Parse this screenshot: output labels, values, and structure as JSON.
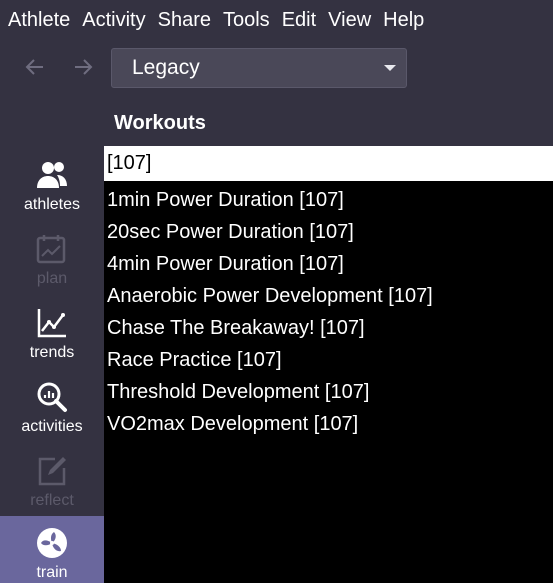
{
  "menu": [
    "Athlete",
    "Activity",
    "Share",
    "Tools",
    "Edit",
    "View",
    "Help"
  ],
  "toolbar": {
    "back_icon": "arrow-left-icon",
    "forward_icon": "arrow-right-icon",
    "view_select_value": "Legacy"
  },
  "sidebar": {
    "items": [
      {
        "label": "athletes",
        "icon": "athletes-icon",
        "enabled": true,
        "active": false
      },
      {
        "label": "plan",
        "icon": "plan-icon",
        "enabled": false,
        "active": false
      },
      {
        "label": "trends",
        "icon": "trends-icon",
        "enabled": true,
        "active": false
      },
      {
        "label": "activities",
        "icon": "activities-icon",
        "enabled": true,
        "active": false
      },
      {
        "label": "reflect",
        "icon": "reflect-icon",
        "enabled": false,
        "active": false
      },
      {
        "label": "train",
        "icon": "train-icon",
        "enabled": true,
        "active": true
      }
    ]
  },
  "workouts": {
    "title": "Workouts",
    "filter_value": "[107]",
    "items": [
      "1min Power Duration [107]",
      "20sec Power Duration [107]",
      "4min Power Duration [107]",
      "Anaerobic Power Development [107]",
      "Chase The Breakaway! [107]",
      "Race Practice [107]",
      "Threshold Development [107]",
      "VO2max Development [107]"
    ]
  },
  "colors": {
    "background": "#343241",
    "active_sidebar": "#6a679d",
    "list_background": "#000000",
    "disabled_text": "#5c5a6a"
  }
}
